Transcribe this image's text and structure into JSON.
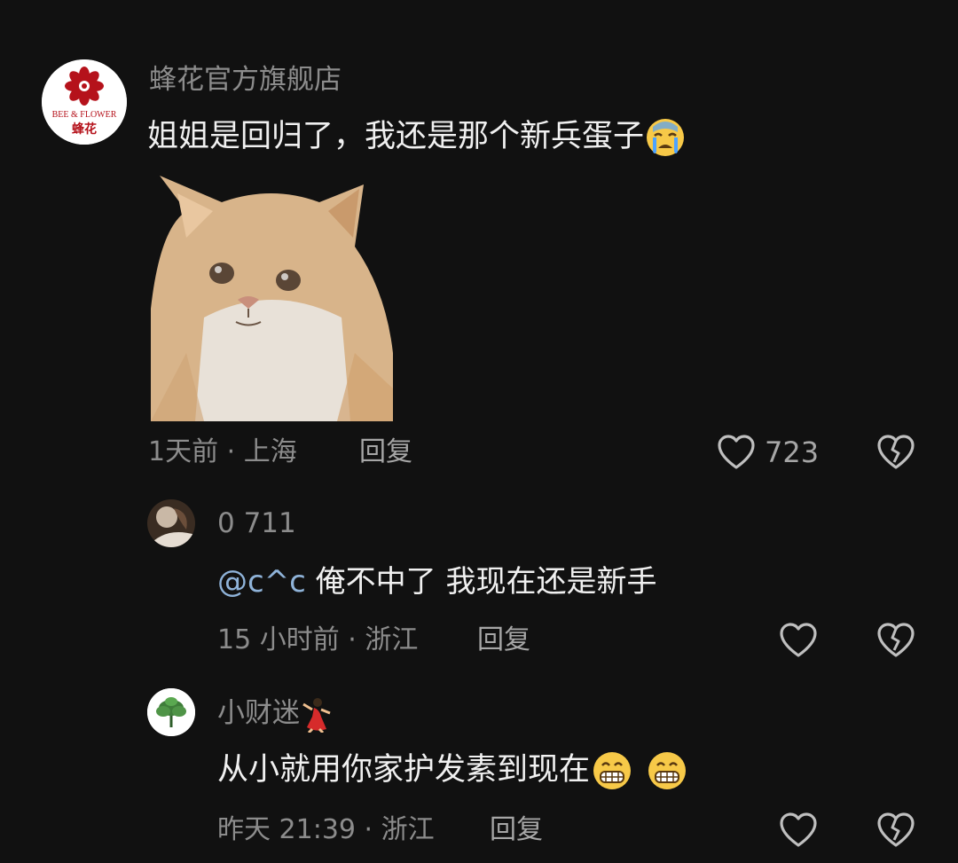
{
  "comment": {
    "username": "蜂花官方旗舰店",
    "avatar_text_top": "BEE & FLOWER",
    "avatar_text_bottom": "蜂花",
    "text": "姐姐是回归了，我还是那个新兵蛋子",
    "emoji": "crying-face",
    "meta": "1天前 · 上海",
    "reply_label": "回复",
    "like_count": "723"
  },
  "replies": [
    {
      "username": "0 711",
      "mention": "@c^c",
      "text": " 俺不中了 我现在还是新手",
      "meta": "15 小时前 · 浙江",
      "reply_label": "回复"
    },
    {
      "username": "小财迷",
      "username_emoji": "dancer",
      "text": "从小就用你家护发素到现在",
      "emojis": [
        "grinning-face",
        "grinning-face"
      ],
      "meta": "昨天 21:39 · 浙江",
      "reply_label": "回复"
    }
  ],
  "colors": {
    "background": "#111111",
    "text": "#f0f0f0",
    "muted": "#8c8c8c",
    "mention": "#8fb3d9",
    "brand_red": "#b5121b"
  }
}
